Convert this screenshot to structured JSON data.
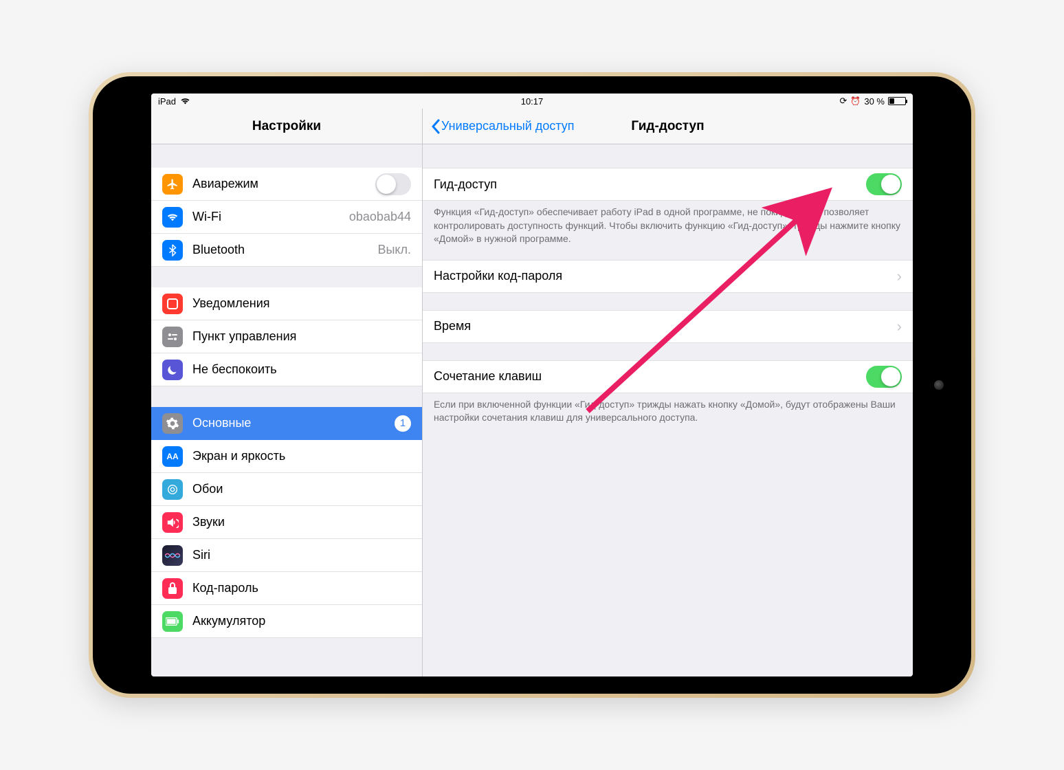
{
  "status": {
    "device": "iPad",
    "time": "10:17",
    "battery_pct": "30 %"
  },
  "sidebar": {
    "title": "Настройки",
    "airplane": "Авиарежим",
    "wifi": "Wi-Fi",
    "wifi_value": "obaobab44",
    "bluetooth": "Bluetooth",
    "bluetooth_value": "Выкл.",
    "notifications": "Уведомления",
    "control_center": "Пункт управления",
    "dnd": "Не беспокоить",
    "general": "Основные",
    "general_badge": "1",
    "display": "Экран и яркость",
    "wallpaper": "Обои",
    "sounds": "Звуки",
    "siri": "Siri",
    "passcode": "Код-пароль",
    "battery": "Аккумулятор"
  },
  "detail": {
    "back": "Универсальный доступ",
    "title": "Гид-доступ",
    "guided_access": "Гид-доступ",
    "guided_desc": "Функция «Гид-доступ» обеспечивает работу iPad в одной программе, не покидая ее, и позволяет контролировать доступность функций. Чтобы включить функцию «Гид-доступ», трижды нажмите кнопку «Домой» в нужной программе.",
    "passcode_settings": "Настройки код-пароля",
    "time_limits": "Время",
    "shortcut": "Сочетание клавиш",
    "shortcut_desc": "Если при включенной функции «Гид-доступ» трижды нажать кнопку «Домой», будут отображены Ваши настройки сочетания клавиш для универсального доступа."
  }
}
